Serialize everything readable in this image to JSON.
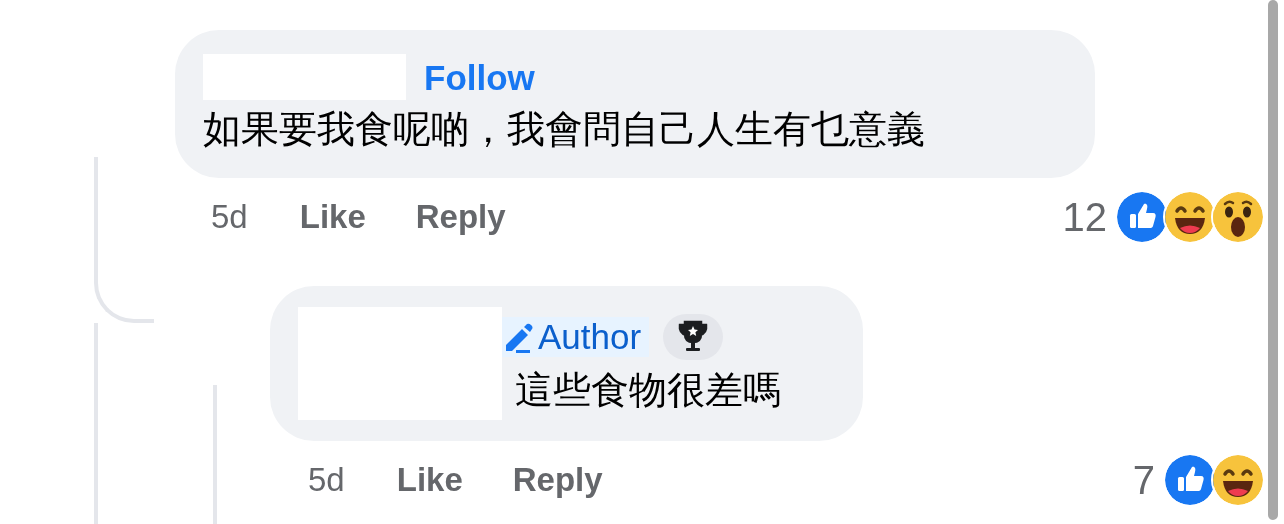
{
  "comments": [
    {
      "follow": "Follow",
      "text": "如果要我食呢啲，我會問自己人生有乜意義",
      "time": "5d",
      "actions": [
        "Like",
        "Reply"
      ],
      "reaction_count": "12",
      "reactions": [
        {
          "kind": "like"
        },
        {
          "kind": "haha"
        },
        {
          "kind": "wow"
        }
      ]
    },
    {
      "badges": [
        {
          "kind": "author",
          "label": "Author"
        },
        {
          "kind": "trophy"
        }
      ],
      "text": "這些食物很差嗎",
      "time": "5d",
      "actions": [
        "Like",
        "Reply"
      ],
      "reaction_count": "7",
      "reactions": [
        {
          "kind": "like"
        },
        {
          "kind": "haha"
        }
      ]
    }
  ]
}
